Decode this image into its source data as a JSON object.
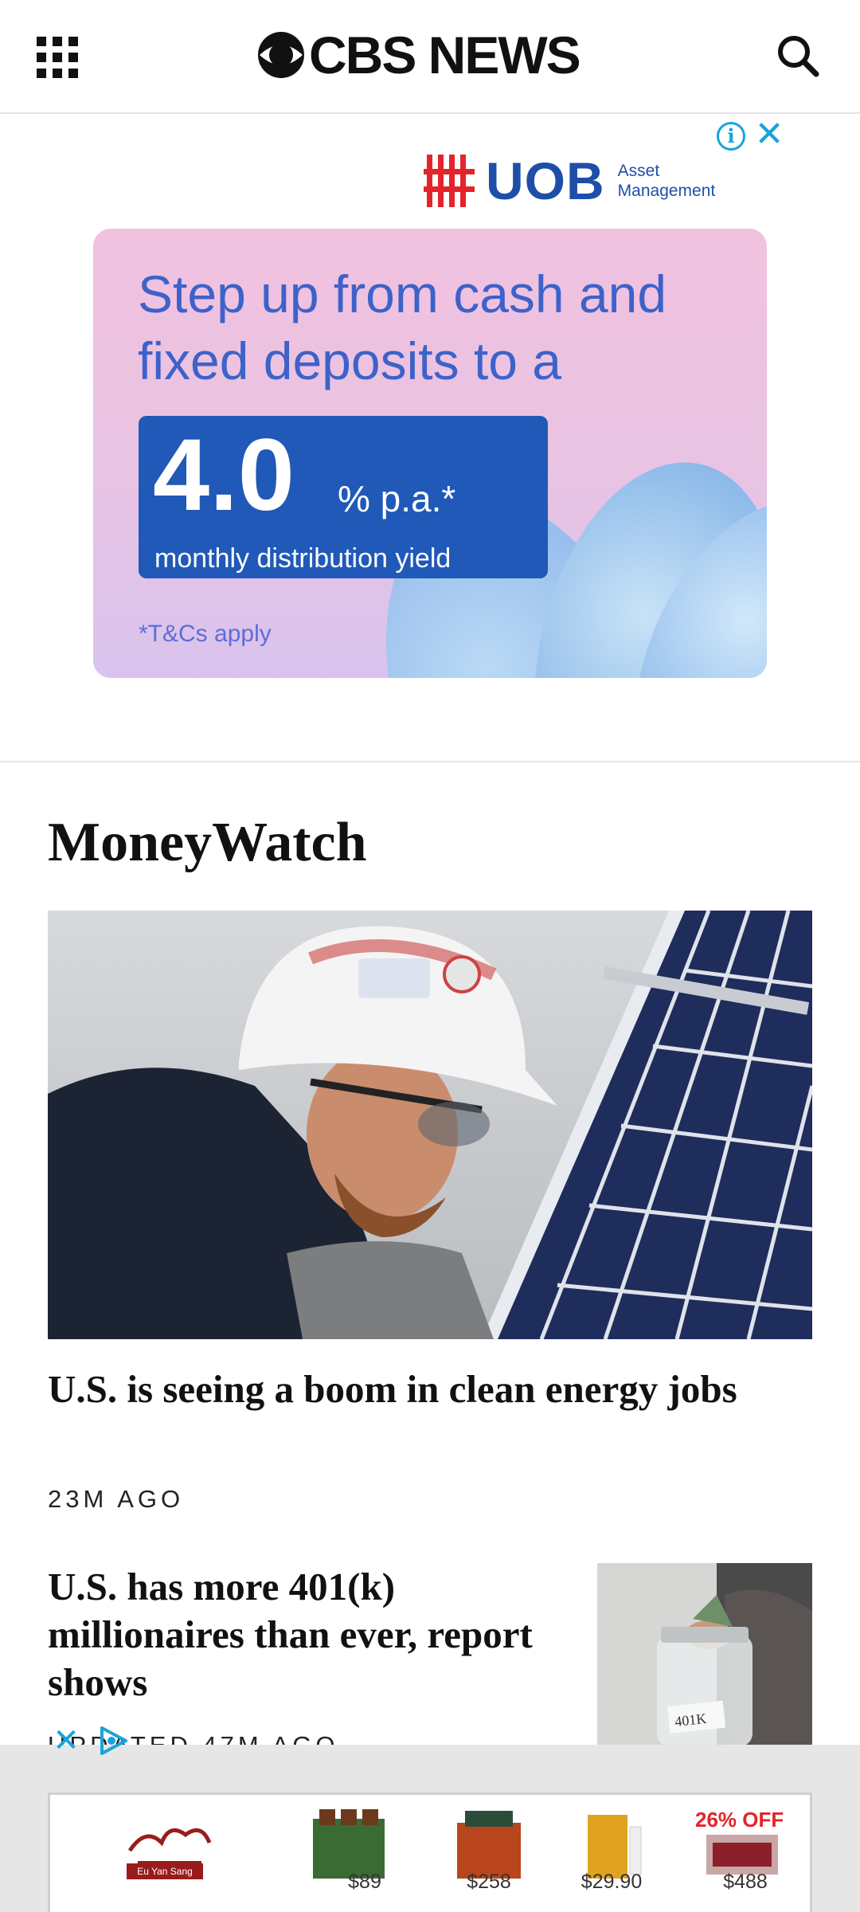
{
  "header": {
    "logo_text": "CBS NEWS"
  },
  "ad_top": {
    "brand": "UOB",
    "brand_sub_line1": "Asset",
    "brand_sub_line2": "Management",
    "headline": "Step up from cash and fixed deposits to a",
    "rate_value": "4.0",
    "rate_suffix": "% p.a.*",
    "rate_caption": "monthly distribution yield",
    "terms": "*T&Cs apply",
    "colors": {
      "brand": "#1e4fa8",
      "accent": "#e3242b",
      "rate_box": "#2059b7"
    }
  },
  "section": {
    "title": "MoneyWatch"
  },
  "stories": [
    {
      "title": "U.S. is seeing a boom in clean energy jobs",
      "time": "23M AGO"
    },
    {
      "title": "U.S. has more 401(k) millionaires than ever, report shows",
      "time": "UPDATED 47M AGO"
    }
  ],
  "ad_bottom": {
    "brand": "Eu Yan Sang",
    "sale_badge": "26% OFF",
    "prices": [
      "$89",
      "$258",
      "$29.90",
      "$488"
    ]
  },
  "icons": [
    "apps-grid-icon",
    "cbs-eye-icon",
    "search-icon",
    "ad-info-icon",
    "close-icon",
    "ad-choices-icon"
  ]
}
